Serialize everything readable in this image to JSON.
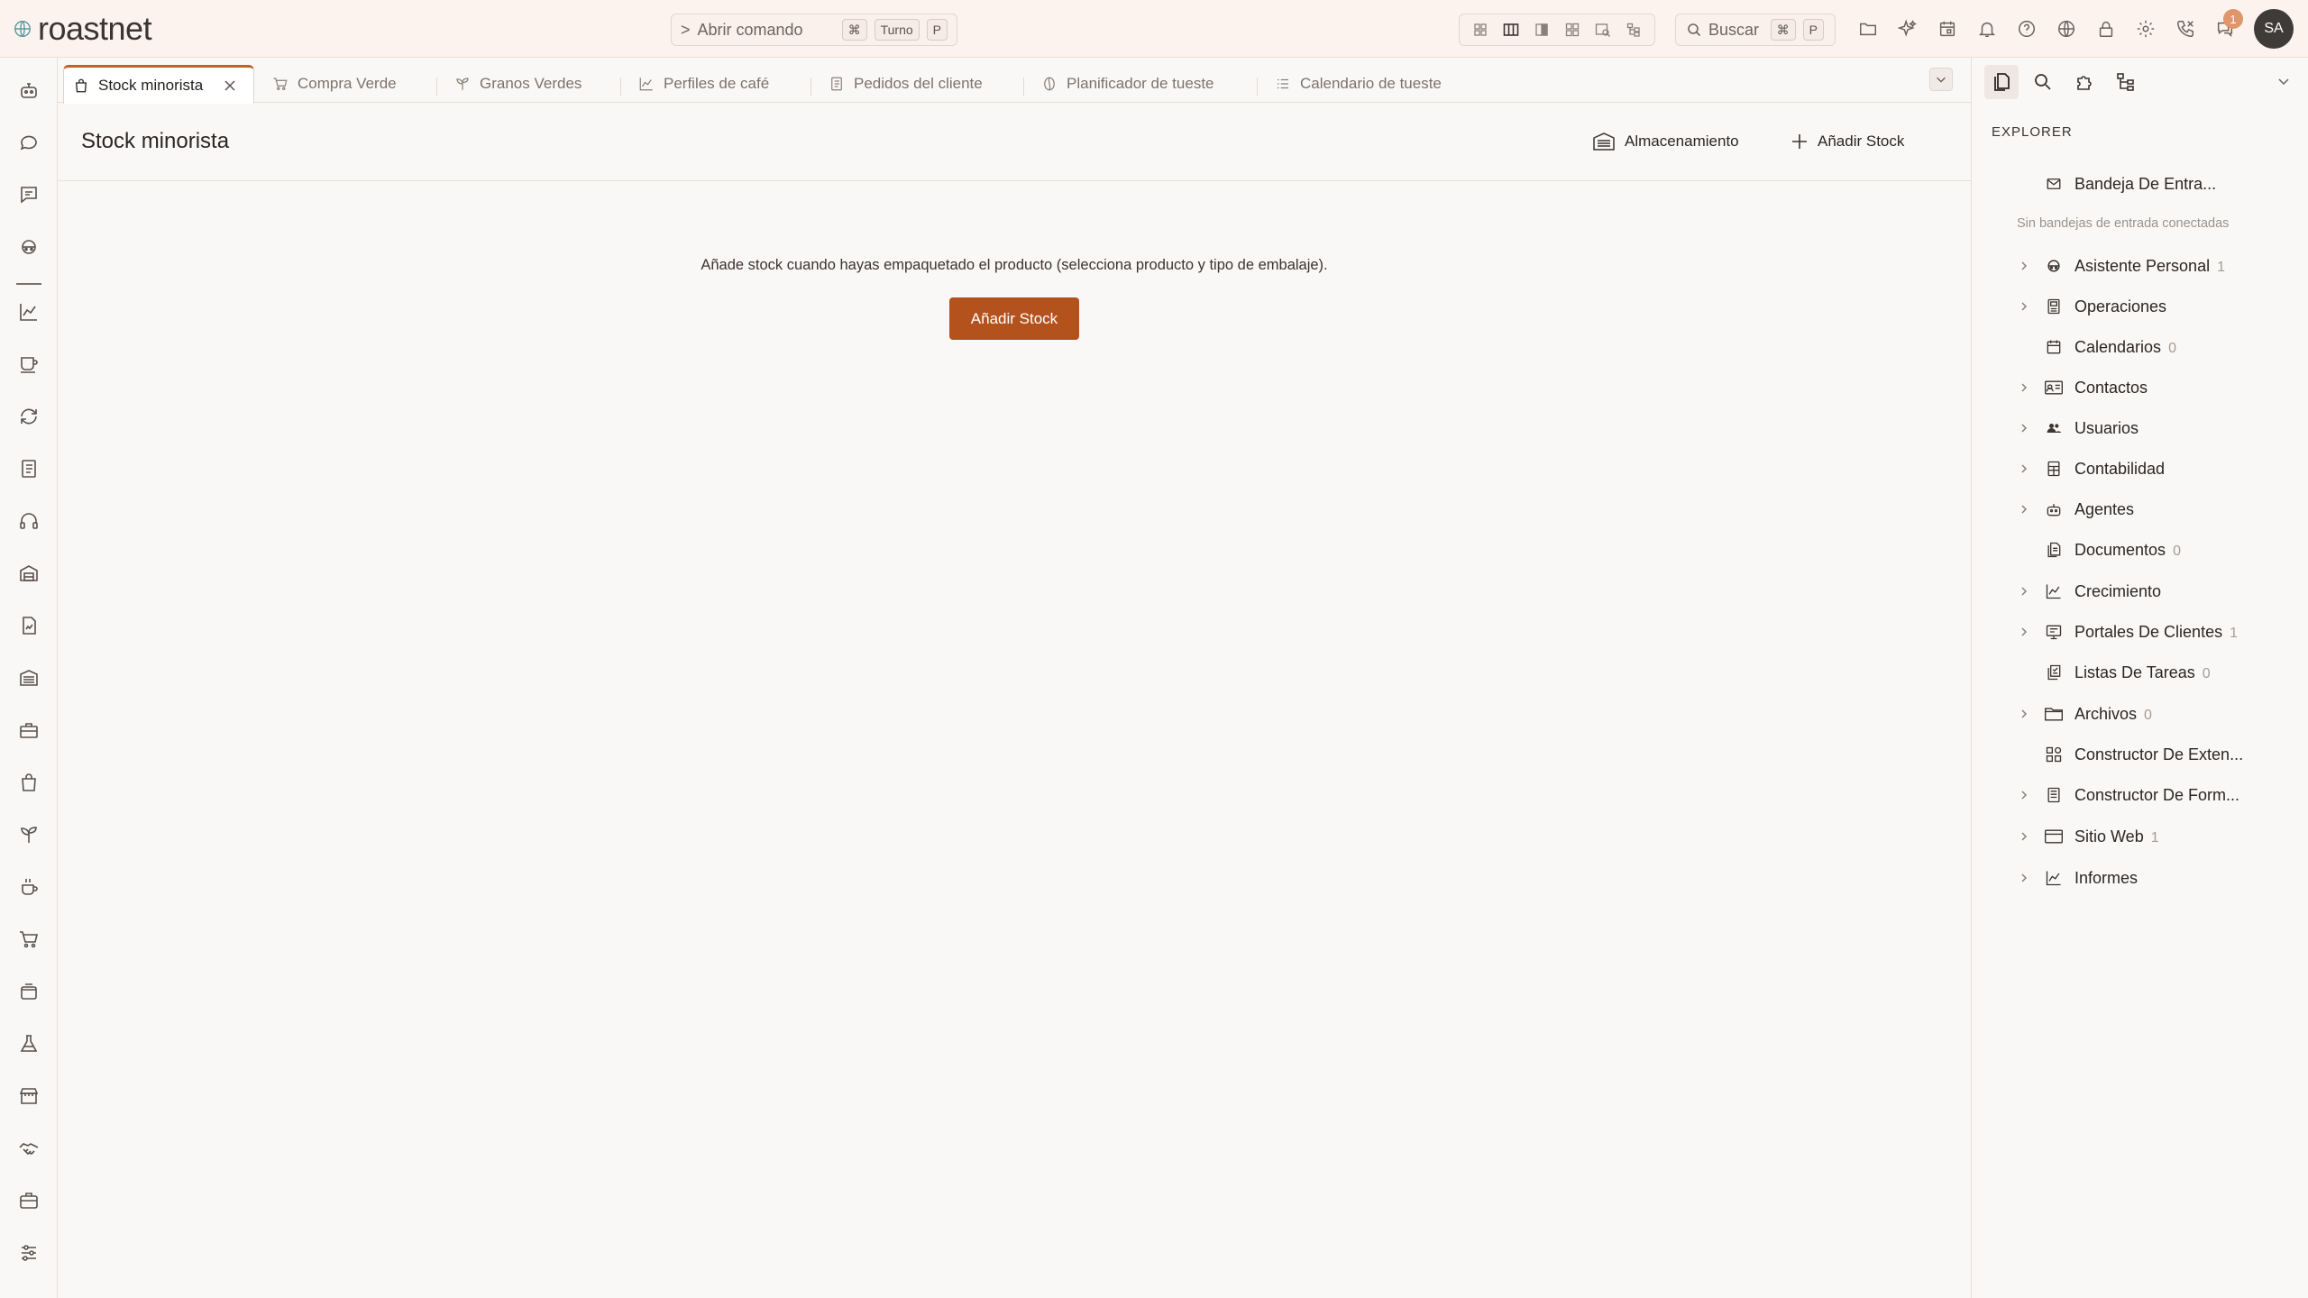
{
  "app": {
    "name": "roastnet",
    "colors": {
      "accent": "#b4521e",
      "active_tab": "#c1612b",
      "topbar_bg": "#fcf3ee",
      "badge": "#e0956a"
    }
  },
  "topbar": {
    "command": {
      "prompt": ">",
      "label": "Abrir comando",
      "keys": [
        "⌘",
        "Turno",
        "P"
      ]
    },
    "layout_icons": [
      "grid-icon",
      "columns-icon",
      "sidebar-icon",
      "tiles-icon",
      "search-window-icon",
      "tree-icon"
    ],
    "search": {
      "label": "Buscar",
      "keys": [
        "⌘",
        "P"
      ]
    },
    "icons": [
      "folder-icon",
      "sparkle-icon",
      "calendar-icon",
      "bell-icon",
      "help-icon",
      "globe-icon",
      "lock-icon",
      "gear-icon",
      "phone-icon",
      "chat-icon"
    ],
    "notification_count": "1",
    "user_initials": "SA"
  },
  "rail": {
    "icons": [
      "robot-icon",
      "chat-bubble-icon",
      "messages-icon",
      "assistant-icon",
      "chart-line-icon",
      "coffee-cup-icon",
      "sync-icon",
      "notebook-icon",
      "headset-icon",
      "warehouse-icon",
      "invoice-icon",
      "storage-icon",
      "toolbox-icon",
      "shopping-bag-icon",
      "sprout-icon",
      "coffee-pot-icon",
      "cart-icon",
      "package-icon",
      "flask-icon",
      "store-icon",
      "handshake-icon",
      "briefcase-icon",
      "sliders-icon"
    ]
  },
  "tabs": [
    {
      "label": "Stock minorista",
      "icon": "bag-icon",
      "active": true
    },
    {
      "label": "Compra Verde",
      "icon": "cart-icon",
      "active": false
    },
    {
      "label": "Granos Verdes",
      "icon": "sprout-icon",
      "active": false
    },
    {
      "label": "Perfiles de café",
      "icon": "chart-line-icon",
      "active": false
    },
    {
      "label": "Pedidos del cliente",
      "icon": "document-icon",
      "active": false
    },
    {
      "label": "Planificador de tueste",
      "icon": "bean-icon",
      "active": false
    },
    {
      "label": "Calendario de tueste",
      "icon": "list-icon",
      "active": false
    }
  ],
  "page": {
    "title": "Stock minorista",
    "actions": {
      "storage": "Almacenamiento",
      "add": "Añadir Stock"
    },
    "empty_message": "Añade stock cuando hayas empaquetado el producto (selecciona producto y tipo de embalaje).",
    "empty_button": "Añadir Stock"
  },
  "explorer": {
    "heading": "EXPLORER",
    "inbox": {
      "label": "Bandeja De Entra...",
      "note": "Sin bandejas de entrada conectadas"
    },
    "items": [
      {
        "label": "Asistente Personal",
        "count": "1",
        "chevron": true,
        "icon": "assistant-icon"
      },
      {
        "label": "Operaciones",
        "count": "",
        "chevron": true,
        "icon": "operations-icon"
      },
      {
        "label": "Calendarios",
        "count": "0",
        "chevron": false,
        "icon": "calendar-icon"
      },
      {
        "label": "Contactos",
        "count": "",
        "chevron": true,
        "icon": "contact-card-icon"
      },
      {
        "label": "Usuarios",
        "count": "",
        "chevron": true,
        "icon": "users-icon"
      },
      {
        "label": "Contabilidad",
        "count": "",
        "chevron": true,
        "icon": "ledger-icon"
      },
      {
        "label": "Agentes",
        "count": "",
        "chevron": true,
        "icon": "robot-icon"
      },
      {
        "label": "Documentos",
        "count": "0",
        "chevron": false,
        "icon": "documents-icon"
      },
      {
        "label": "Crecimiento",
        "count": "",
        "chevron": true,
        "icon": "chart-line-icon"
      },
      {
        "label": "Portales De Clientes",
        "count": "1",
        "chevron": true,
        "icon": "portal-icon"
      },
      {
        "label": "Listas De Tareas",
        "count": "0",
        "chevron": false,
        "icon": "task-list-icon"
      },
      {
        "label": "Archivos",
        "count": "0",
        "chevron": true,
        "icon": "folder-icon"
      },
      {
        "label": "Constructor De Exten...",
        "count": "",
        "chevron": false,
        "icon": "puzzle-blocks-icon"
      },
      {
        "label": "Constructor De Form...",
        "count": "",
        "chevron": true,
        "icon": "form-icon"
      },
      {
        "label": "Sitio Web",
        "count": "1",
        "chevron": true,
        "icon": "browser-icon"
      },
      {
        "label": "Informes",
        "count": "",
        "chevron": true,
        "icon": "chart-line-icon"
      }
    ]
  }
}
